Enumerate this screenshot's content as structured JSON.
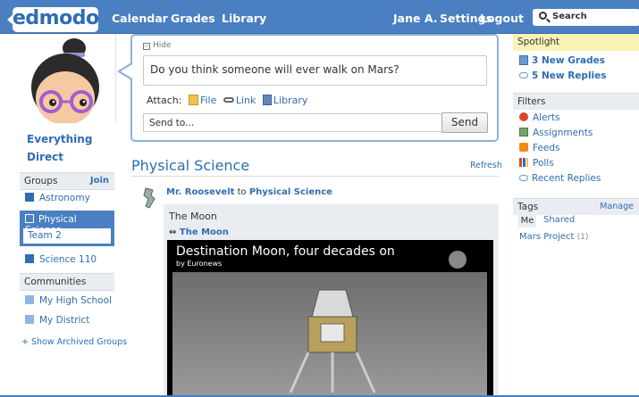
{
  "header": {
    "logo": "edmodo",
    "nav": [
      "Calendar",
      "Grades",
      "Library"
    ],
    "user": "Jane A.",
    "settings": "Settings",
    "logout": "Logout",
    "search_placeholder": "Search"
  },
  "sidebar": {
    "everything": "Everything",
    "direct": "Direct",
    "groups_head": "Groups",
    "join": "Join",
    "groups": [
      "Astronomy",
      "Physical Science",
      "Team 2",
      "Science 110"
    ],
    "communities_head": "Communities",
    "communities": [
      "My High School",
      "My District"
    ],
    "show_archived": "+ Show Archived Groups"
  },
  "compose": {
    "hide": "Hide",
    "post_text": "Do you think someone will ever walk on Mars?",
    "attach_label": "Attach:",
    "attach_file": "File",
    "attach_link": "Link",
    "attach_library": "Library",
    "send_to_placeholder": "Send to...",
    "send": "Send"
  },
  "stream": {
    "title": "Physical Science",
    "refresh": "Refresh",
    "post": {
      "author": "Mr. Roosevelt",
      "to_word": "to",
      "group": "Physical Science",
      "text": "The Moon",
      "link_label": "The Moon",
      "video_title": "Destination Moon, four decades on",
      "video_sub": "by Euronews",
      "video_brand": "euronews"
    }
  },
  "right": {
    "spotlight": "Spotlight",
    "spot_items": [
      "3 New Grades",
      "5 New Replies"
    ],
    "filters": "Filters",
    "filter_items": [
      "Alerts",
      "Assignments",
      "Feeds",
      "Polls",
      "Recent Replies"
    ],
    "tags": "Tags",
    "manage": "Manage",
    "tag_tab_me": "Me",
    "tag_tab_shared": "Shared",
    "tag_name": "Mars Project",
    "tag_count": "(1)"
  },
  "colors": {
    "brand": "#4a7fc1",
    "link": "#2f6db3",
    "spotlight_bg": "#f9f3b6"
  }
}
